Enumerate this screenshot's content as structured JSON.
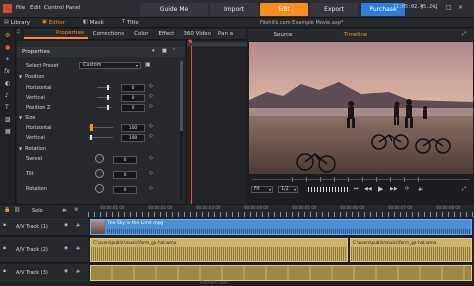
{
  "menu": {
    "items": [
      "File",
      "Edit",
      "Control Panel"
    ]
  },
  "top_buttons": {
    "guide": "Guide Me",
    "import": "Import",
    "edit": "Edit",
    "export": "Export",
    "purchase": "Purchase"
  },
  "timecode_top": "[1:05:02.45.24]",
  "tab_row": {
    "library": "Library",
    "editor": "Editor",
    "mask": "Mask",
    "title": "Title",
    "filename": "Filehills.com Example Movie.axp*"
  },
  "editor_tabs": {
    "items": [
      "Properties",
      "Corrections",
      "Color",
      "Effect",
      "360 Video",
      "Pan a"
    ]
  },
  "properties": {
    "header": "Properties",
    "select_preset_label": "Select Preset",
    "select_preset_value": "Custom",
    "position_section": "Position",
    "horizontal_label": "Horizontal",
    "horizontal_value": "0",
    "vertical_label": "Vertical",
    "vertical_value": "0",
    "position_z_label": "Position Z",
    "position_z_value": "0",
    "size_section": "Size",
    "size_h_label": "Horizontal",
    "size_h_value": "100",
    "size_v_label": "Vertical",
    "size_v_value": "100",
    "rotation_section": "Rotation",
    "swivel_label": "Swivel",
    "swivel_value": "0",
    "tilt_label": "Tilt",
    "tilt_value": "0",
    "rotation_label": "Rotation",
    "rotation_value": "0"
  },
  "preview": {
    "source_tab": "Source",
    "timeline_tab": "Timeline",
    "fit_label": "Fit",
    "ratio_label": "1/2",
    "time_label": "00:00:00:00"
  },
  "timeline": {
    "solo_label": "Solo",
    "ruler_ticks": [
      "00:00:01:00",
      "00:00:02:00",
      "00:00:03:00",
      "00:00:04:00",
      "00:00:05:00",
      "00:00:06:00",
      "00:00:07:00",
      "00:00:08:00"
    ],
    "track1": {
      "name": "A/V Track (1)",
      "title_clip": "The-Sky-is-the-Limit.mpg"
    },
    "track2": {
      "name": "A/V Track (2)",
      "audio_clip_a": "C:\\users\\public\\music\\form_go-hat.wma",
      "audio_clip_b": "C:\\users\\public\\music\\form_go-hat.wma"
    },
    "track3": {
      "name": "A/V Track (3)"
    },
    "bottom_text": "FileHills.com"
  },
  "colors": {
    "accent": "#ff8a1e",
    "purchase": "#2a7de1",
    "panel": "#26292e",
    "video_clip": "#4c8fd6",
    "audio_clip": "#c9b46a"
  }
}
